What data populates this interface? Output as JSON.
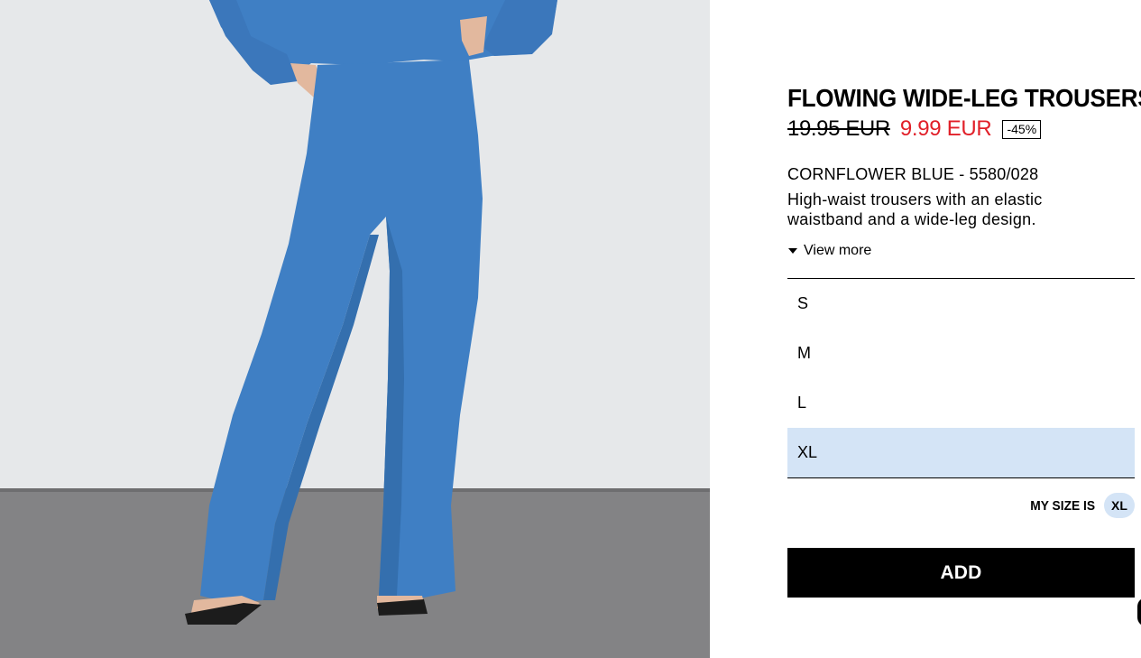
{
  "product": {
    "title": "FLOWING WIDE-LEG TROUSERS",
    "old_price": "19.95 EUR",
    "new_price": "9.99 EUR",
    "discount": "-45%",
    "color_ref": "CORNFLOWER BLUE - 5580/028",
    "description": "High-waist trousers with an elastic waistband and a wide-leg design.",
    "view_more": "View more",
    "image_alt_icon": "model-photo"
  },
  "sizes": {
    "options": [
      "S",
      "M",
      "L",
      "XL"
    ],
    "selected": "XL"
  },
  "my_size": {
    "label": "MY SIZE IS",
    "value": "XL"
  },
  "add_button": {
    "label": "ADD"
  },
  "colors": {
    "sale_red": "#e12029",
    "selected_bg": "#d4e4f6",
    "garment_blue": "#3f7fc4"
  }
}
